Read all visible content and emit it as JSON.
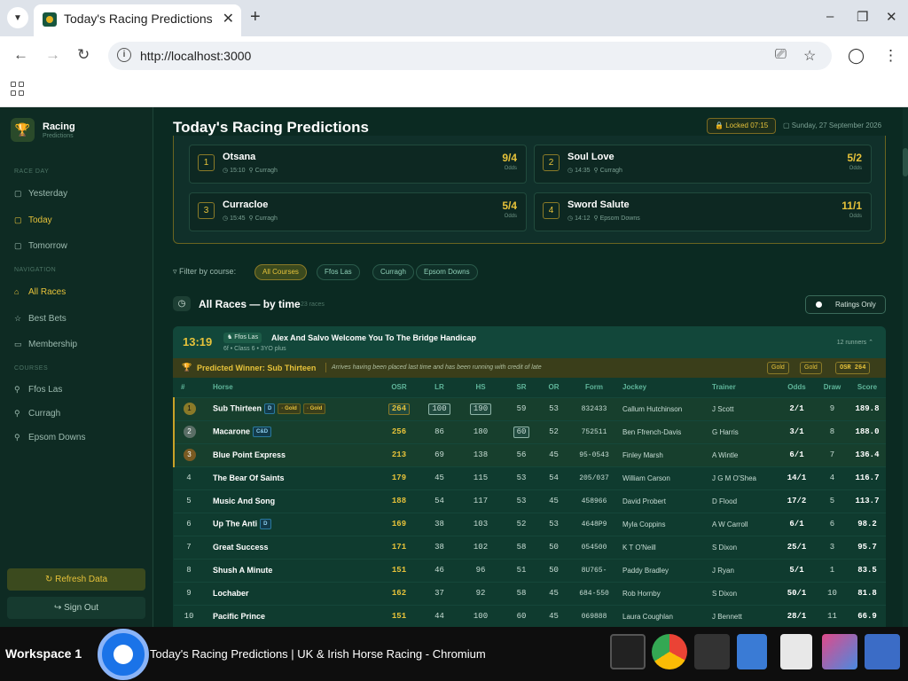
{
  "browser": {
    "tab_title": "Today's Racing Predictions",
    "url": "http://localhost:3000"
  },
  "sidebar": {
    "brand": "Racing",
    "brand_sub": "Predictions",
    "section_raceday": "Race Day",
    "yesterday": "Yesterday",
    "today": "Today",
    "tomorrow": "Tomorrow",
    "section_navigation": "Navigation",
    "all_races": "All Races",
    "best_bets": "Best Bets",
    "membership": "Membership",
    "section_courses": "Courses",
    "course1": "Ffos Las",
    "course2": "Curragh",
    "course3": "Epsom Downs",
    "refresh": "Refresh Data",
    "signout": "Sign Out"
  },
  "header": {
    "title": "Today's Racing Predictions",
    "locked": "Locked 07:15",
    "date": "Sunday, 27 September 2026"
  },
  "predictions": [
    {
      "num": "1",
      "name": "Otsana",
      "time": "15:10",
      "course": "Curragh",
      "odds": "9/4",
      "odds_label": "Odds"
    },
    {
      "num": "2",
      "name": "Soul Love",
      "time": "14:35",
      "course": "Curragh",
      "odds": "5/2",
      "odds_label": "Odds"
    },
    {
      "num": "3",
      "name": "Curracloe",
      "time": "15:45",
      "course": "Curragh",
      "odds": "5/4",
      "odds_label": "Odds"
    },
    {
      "num": "4",
      "name": "Sword Salute",
      "time": "14:12",
      "course": "Epsom Downs",
      "odds": "11/1",
      "odds_label": "Odds"
    }
  ],
  "filter": {
    "label": "Filter by course:",
    "chips": [
      "All Courses",
      "Ffos Las",
      "Curragh",
      "Epsom Downs"
    ]
  },
  "all_races": {
    "title": "All Races — by time",
    "count": "23 races",
    "ratings_toggle": "Ratings Only"
  },
  "race": {
    "time": "13:19",
    "course": "Ffos Las",
    "name": "Alex And Salvo Welcome You To The Bridge Handicap",
    "meta": "6f • Class 6 • 3YO plus",
    "runners": "12 runners",
    "winner_label": "Predicted Winner: Sub Thirteen",
    "winner_desc": "Arrives having been placed last time and has been running with credit of late",
    "badge1": "Gold",
    "badge2": "Gold",
    "badge_osr": "OSR 264",
    "columns": [
      "#",
      "Horse",
      "OSR",
      "LR",
      "HS",
      "SR",
      "OR",
      "Form",
      "Jockey",
      "Trainer",
      "Odds",
      "Draw",
      "Score"
    ]
  },
  "runners": [
    [
      "1",
      "Sub Thirteen",
      "264",
      "100",
      "190",
      "59",
      "53",
      "832433",
      "Callum Hutchinson",
      "J Scott",
      "2/1",
      "9",
      "189.8"
    ],
    [
      "2",
      "Macarone",
      "256",
      "86",
      "180",
      "60",
      "52",
      "752511",
      "Ben Ffrench-Davis",
      "G Harris",
      "3/1",
      "8",
      "188.0"
    ],
    [
      "3",
      "Blue Point Express",
      "213",
      "69",
      "138",
      "56",
      "45",
      "95-0543",
      "Finley Marsh",
      "A Wintle",
      "6/1",
      "7",
      "136.4"
    ],
    [
      "4",
      "The Bear Of Saints",
      "179",
      "45",
      "115",
      "53",
      "54",
      "205/037",
      "William Carson",
      "J G M O'Shea",
      "14/1",
      "4",
      "116.7"
    ],
    [
      "5",
      "Music And Song",
      "188",
      "54",
      "117",
      "53",
      "45",
      "458966",
      "David Probert",
      "D Flood",
      "17/2",
      "5",
      "113.7"
    ],
    [
      "6",
      "Up The Anti",
      "169",
      "38",
      "103",
      "52",
      "53",
      "4648P9",
      "Myla Coppins",
      "A W Carroll",
      "6/1",
      "6",
      "98.2"
    ],
    [
      "7",
      "Great Success",
      "171",
      "38",
      "102",
      "58",
      "50",
      "054500",
      "K T O'Neill",
      "S Dixon",
      "25/1",
      "3",
      "95.7"
    ],
    [
      "8",
      "Shush A Minute",
      "151",
      "46",
      "96",
      "51",
      "50",
      "8U765-",
      "Paddy Bradley",
      "J Ryan",
      "5/1",
      "1",
      "83.5"
    ],
    [
      "9",
      "Lochaber",
      "162",
      "37",
      "92",
      "58",
      "45",
      "684-550",
      "Rob Hornby",
      "S Dixon",
      "50/1",
      "10",
      "81.8"
    ],
    [
      "10",
      "Pacific Prince",
      "151",
      "44",
      "100",
      "60",
      "45",
      "069888",
      "Laura Coughlan",
      "J Bennett",
      "28/1",
      "11",
      "66.9"
    ]
  ],
  "horse_tags": {
    "sub_thirteen": [
      "D",
      "Gold",
      "Gold"
    ],
    "macarone": [
      "C&D"
    ],
    "up_the_anti": [
      "D"
    ]
  },
  "taskbar": {
    "workspace": "Workspace 1",
    "window_title": "Today's Racing Predictions | UK & Irish Horse Racing - Chromium"
  }
}
